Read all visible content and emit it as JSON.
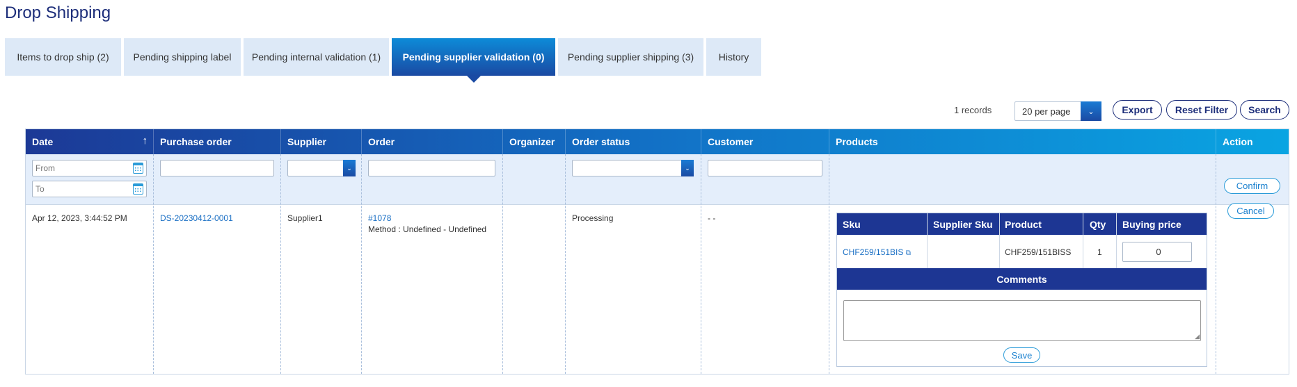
{
  "page_title": "Drop Shipping",
  "tabs": [
    {
      "label": "Items to drop ship (2)"
    },
    {
      "label": "Pending shipping label"
    },
    {
      "label": "Pending internal validation (1)"
    },
    {
      "label": "Pending supplier validation (0)",
      "active": true
    },
    {
      "label": "Pending supplier shipping (3)"
    },
    {
      "label": "History"
    }
  ],
  "toolbar": {
    "records": "1 records",
    "per_page": "20 per page",
    "export_label": "Export",
    "reset_label": "Reset Filter",
    "search_label": "Search"
  },
  "columns": [
    "Date",
    "Purchase order",
    "Supplier",
    "Order",
    "Organizer",
    "Order status",
    "Customer",
    "Products",
    "Action"
  ],
  "sort_arrow": "↑",
  "filters": {
    "date_from_placeholder": "From",
    "date_to_placeholder": "To"
  },
  "row": {
    "date": "Apr 12, 2023, 3:44:52 PM",
    "purchase_order": "DS-20230412-0001",
    "supplier": "Supplier1",
    "order_number": "#1078",
    "order_method": "Method : Undefined - Undefined",
    "organizer": "",
    "order_status": "Processing",
    "customer": "- -",
    "products": {
      "columns": [
        "Sku",
        "Supplier Sku",
        "Product",
        "Qty",
        "Buying price"
      ],
      "items": [
        {
          "sku": "CHF259/151BIS",
          "supplier_sku": "",
          "product": "CHF259/151BISS",
          "qty": "1",
          "buying_price": "0"
        }
      ],
      "comments_title": "Comments",
      "save_label": "Save"
    },
    "confirm_label": "Confirm",
    "cancel_label": "Cancel"
  },
  "colors": {
    "title": "#1d2e7a",
    "accent": "#1a4aa3",
    "link": "#1a6fc4",
    "tab_bg": "#dde9f7"
  }
}
